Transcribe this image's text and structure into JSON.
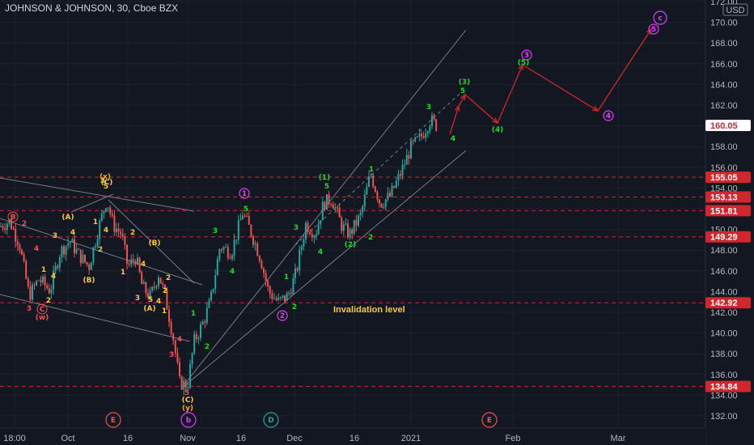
{
  "chart_data": {
    "type": "candlestick",
    "title": "JOHNSON & JOHNSON, 30, Cboe BZX",
    "currency_badge": "USD",
    "ylim": [
      131,
      172
    ],
    "y_ticks": [
      "132.00",
      "134.00",
      "136.00",
      "138.00",
      "140.00",
      "142.00",
      "144.00",
      "146.00",
      "148.00",
      "150.00",
      "152.00",
      "154.00",
      "156.00",
      "158.00",
      "160.00",
      "162.00",
      "164.00",
      "166.00",
      "168.00",
      "170.00",
      "172.00"
    ],
    "x_ticks": [
      "18:00",
      "Oct",
      "16",
      "Nov",
      "16",
      "Dec",
      "16",
      "2021",
      "Feb",
      "Mar"
    ],
    "level_lines": [
      {
        "value": 155.05,
        "label": "155.05"
      },
      {
        "value": 153.13,
        "label": "153.13"
      },
      {
        "value": 151.81,
        "label": "151.81"
      },
      {
        "value": 149.29,
        "label": "149.29"
      },
      {
        "value": 142.92,
        "label": "142.92"
      },
      {
        "value": 134.84,
        "label": "134.84"
      }
    ],
    "last_price": {
      "value": 160.05,
      "label": "160.05"
    },
    "annotation": {
      "text": "Invalidation level",
      "color": "#f5c842"
    },
    "price_path": [
      [
        0,
        150.3
      ],
      [
        12,
        150.8
      ],
      [
        24,
        148.6
      ],
      [
        36,
        143.6
      ],
      [
        48,
        145.2
      ],
      [
        62,
        144.1
      ],
      [
        74,
        147.8
      ],
      [
        86,
        148.9
      ],
      [
        98,
        147.5
      ],
      [
        110,
        146.4
      ],
      [
        122,
        150.2
      ],
      [
        132,
        152.9
      ],
      [
        140,
        150.4
      ],
      [
        150,
        149.6
      ],
      [
        158,
        146.4
      ],
      [
        168,
        147.3
      ],
      [
        176,
        144.4
      ],
      [
        186,
        143.5
      ],
      [
        196,
        145.7
      ],
      [
        204,
        143.6
      ],
      [
        214,
        139.6
      ],
      [
        222,
        135.2
      ],
      [
        232,
        135.0
      ],
      [
        240,
        139.2
      ],
      [
        250,
        140.8
      ],
      [
        260,
        143.0
      ],
      [
        272,
        148.4
      ],
      [
        286,
        147.8
      ],
      [
        300,
        151.6
      ],
      [
        310,
        149.8
      ],
      [
        322,
        147.2
      ],
      [
        332,
        144.0
      ],
      [
        344,
        143.0
      ],
      [
        356,
        143.6
      ],
      [
        366,
        145.8
      ],
      [
        378,
        150.5
      ],
      [
        390,
        149.6
      ],
      [
        400,
        152.5
      ],
      [
        410,
        153.0
      ],
      [
        422,
        150.4
      ],
      [
        432,
        149.5
      ],
      [
        446,
        151.4
      ],
      [
        458,
        155.4
      ],
      [
        470,
        152.5
      ],
      [
        482,
        153.2
      ],
      [
        494,
        155.2
      ],
      [
        508,
        157.9
      ],
      [
        520,
        158.9
      ],
      [
        532,
        160.6
      ],
      [
        540,
        160.0
      ]
    ],
    "trend_lines": [
      [
        [
          228,
          475
        ],
        [
          576,
          37
        ]
      ],
      [
        [
          228,
          477
        ],
        [
          576,
          186
        ]
      ],
      [
        [
          365,
          303
        ],
        [
          568,
          116
        ]
      ],
      [
        [
          0,
          220
        ],
        [
          240,
          261
        ]
      ],
      [
        [
          0,
          270
        ],
        [
          250,
          352
        ]
      ],
      [
        [
          0,
          364
        ],
        [
          235,
          422
        ]
      ],
      [
        [
          88,
          262
        ],
        [
          140,
          240
        ]
      ],
      [
        [
          134,
          247
        ],
        [
          240,
          350
        ]
      ]
    ],
    "forecast_path": [
      [
        556,
        166
      ],
      [
        567,
        131
      ],
      [
        575,
        117
      ],
      [
        615,
        152
      ],
      [
        646,
        80
      ],
      [
        739,
        137
      ],
      [
        805,
        36
      ]
    ],
    "forecast_color": "#d0272e",
    "wave_labels": [
      {
        "t": "B",
        "x": 16,
        "y": 271,
        "c": "#ef5350",
        "circle": true
      },
      {
        "t": "2",
        "x": 30,
        "y": 279,
        "c": "#ef5350"
      },
      {
        "t": "4",
        "x": 45,
        "y": 310,
        "c": "#ef5350"
      },
      {
        "t": "3",
        "x": 36,
        "y": 384,
        "c": "#ef5350"
      },
      {
        "t": "C",
        "x": 52,
        "y": 385,
        "c": "#ef5350",
        "circle": true
      },
      {
        "t": "(w)",
        "x": 52,
        "y": 395,
        "c": "#ef5350"
      },
      {
        "t": "2",
        "x": 60,
        "y": 374,
        "c": "#f5c842"
      },
      {
        "t": "1",
        "x": 54,
        "y": 336,
        "c": "#f5c842"
      },
      {
        "t": "4",
        "x": 66,
        "y": 344,
        "c": "#f5c842"
      },
      {
        "t": "3",
        "x": 68,
        "y": 294,
        "c": "#f5c842"
      },
      {
        "t": "(A)",
        "x": 84,
        "y": 271,
        "c": "#f5c842"
      },
      {
        "t": "4",
        "x": 90,
        "y": 290,
        "c": "#f5c842"
      },
      {
        "t": "(B)",
        "x": 110,
        "y": 349,
        "c": "#f5c842"
      },
      {
        "t": "1",
        "x": 118,
        "y": 277,
        "c": "#f5c842"
      },
      {
        "t": "2",
        "x": 124,
        "y": 311,
        "c": "#f5c842"
      },
      {
        "t": "3",
        "x": 127,
        "y": 226,
        "c": "#f5c842"
      },
      {
        "t": "4",
        "x": 131,
        "y": 287,
        "c": "#f5c842"
      },
      {
        "t": "(x)",
        "x": 130,
        "y": 221,
        "c": "#f5a623"
      },
      {
        "t": "(C)",
        "x": 132,
        "y": 228,
        "c": "#f5c842"
      },
      {
        "t": "5",
        "x": 131,
        "y": 233,
        "c": "#f5c842"
      },
      {
        "t": "2",
        "x": 164,
        "y": 290,
        "c": "#f5c842"
      },
      {
        "t": "1",
        "x": 152,
        "y": 339,
        "c": "#f5c842"
      },
      {
        "t": "4",
        "x": 177,
        "y": 329,
        "c": "#f5c842"
      },
      {
        "t": "(B)",
        "x": 191,
        "y": 303,
        "c": "#f5c842"
      },
      {
        "t": "3",
        "x": 170,
        "y": 371,
        "c": "#f5c842"
      },
      {
        "t": "5",
        "x": 186,
        "y": 373,
        "c": "#f5c842"
      },
      {
        "t": "(A)",
        "x": 185,
        "y": 384,
        "c": "#f5c842"
      },
      {
        "t": "2",
        "x": 208,
        "y": 346,
        "c": "#f5c842"
      },
      {
        "t": "1",
        "x": 203,
        "y": 387,
        "c": "#f5c842"
      },
      {
        "t": "4",
        "x": 196,
        "y": 375,
        "c": "#f5c842"
      },
      {
        "t": "2",
        "x": 204,
        "y": 362,
        "c": "#f5c842"
      },
      {
        "t": "3",
        "x": 212,
        "y": 441,
        "c": "#ef5350"
      },
      {
        "t": "4",
        "x": 222,
        "y": 422,
        "c": "#ef5350"
      },
      {
        "t": "5",
        "x": 231,
        "y": 488,
        "c": "#ef5350"
      },
      {
        "t": "(C)",
        "x": 232,
        "y": 497,
        "c": "#f5c842"
      },
      {
        "t": "(y)",
        "x": 232,
        "y": 507,
        "c": "#f5a623"
      },
      {
        "t": "1",
        "x": 239,
        "y": 390,
        "c": "#26d62a"
      },
      {
        "t": "2",
        "x": 256,
        "y": 431,
        "c": "#26d62a"
      },
      {
        "t": "3",
        "x": 266,
        "y": 288,
        "c": "#26d62a"
      },
      {
        "t": "4",
        "x": 287,
        "y": 338,
        "c": "#26d62a"
      },
      {
        "t": "5",
        "x": 304,
        "y": 261,
        "c": "#26d62a"
      },
      {
        "t": "1",
        "x": 354,
        "y": 345,
        "c": "#26d62a"
      },
      {
        "t": "2",
        "x": 364,
        "y": 382,
        "c": "#26d62a"
      },
      {
        "t": "3",
        "x": 366,
        "y": 284,
        "c": "#26d62a"
      },
      {
        "t": "4",
        "x": 396,
        "y": 314,
        "c": "#26d62a"
      },
      {
        "t": "(1)",
        "x": 401,
        "y": 222,
        "c": "#26d62a"
      },
      {
        "t": "5",
        "x": 404,
        "y": 233,
        "c": "#26d62a"
      },
      {
        "t": "(2)",
        "x": 433,
        "y": 305,
        "c": "#26d62a"
      },
      {
        "t": "2",
        "x": 458,
        "y": 296,
        "c": "#26d62a"
      },
      {
        "t": "1",
        "x": 459,
        "y": 212,
        "c": "#26d62a"
      },
      {
        "t": "3",
        "x": 530,
        "y": 135,
        "c": "#26d62a"
      },
      {
        "t": "4",
        "x": 560,
        "y": 174,
        "c": "#26d62a"
      },
      {
        "t": "(3)",
        "x": 574,
        "y": 104,
        "c": "#26d62a"
      },
      {
        "t": "5",
        "x": 572,
        "y": 115,
        "c": "#26d62a"
      },
      {
        "t": "(4)",
        "x": 615,
        "y": 163,
        "c": "#26d62a"
      },
      {
        "t": "(5)",
        "x": 647,
        "y": 80,
        "c": "#26d62a"
      }
    ],
    "circle_labels": [
      {
        "t": "1",
        "x": 302,
        "y": 239,
        "c": "#e040fb"
      },
      {
        "t": "2",
        "x": 349,
        "y": 390,
        "c": "#e040fb"
      },
      {
        "t": "3",
        "x": 651,
        "y": 68,
        "c": "#e040fb"
      },
      {
        "t": "4",
        "x": 752,
        "y": 143,
        "c": "#e040fb"
      },
      {
        "t": "5",
        "x": 808,
        "y": 36,
        "c": "#e040fb"
      },
      {
        "t": "c",
        "x": 816,
        "y": 22,
        "c": "#e040fb",
        "big": true
      }
    ],
    "bottom_labels": [
      {
        "t": "E",
        "x": 140,
        "c": "#ef5350"
      },
      {
        "t": "b",
        "x": 233,
        "c": "#e040fb"
      },
      {
        "t": "D",
        "x": 335,
        "c": "#26a69a"
      },
      {
        "t": "E",
        "x": 605,
        "c": "#ef5350"
      }
    ]
  }
}
